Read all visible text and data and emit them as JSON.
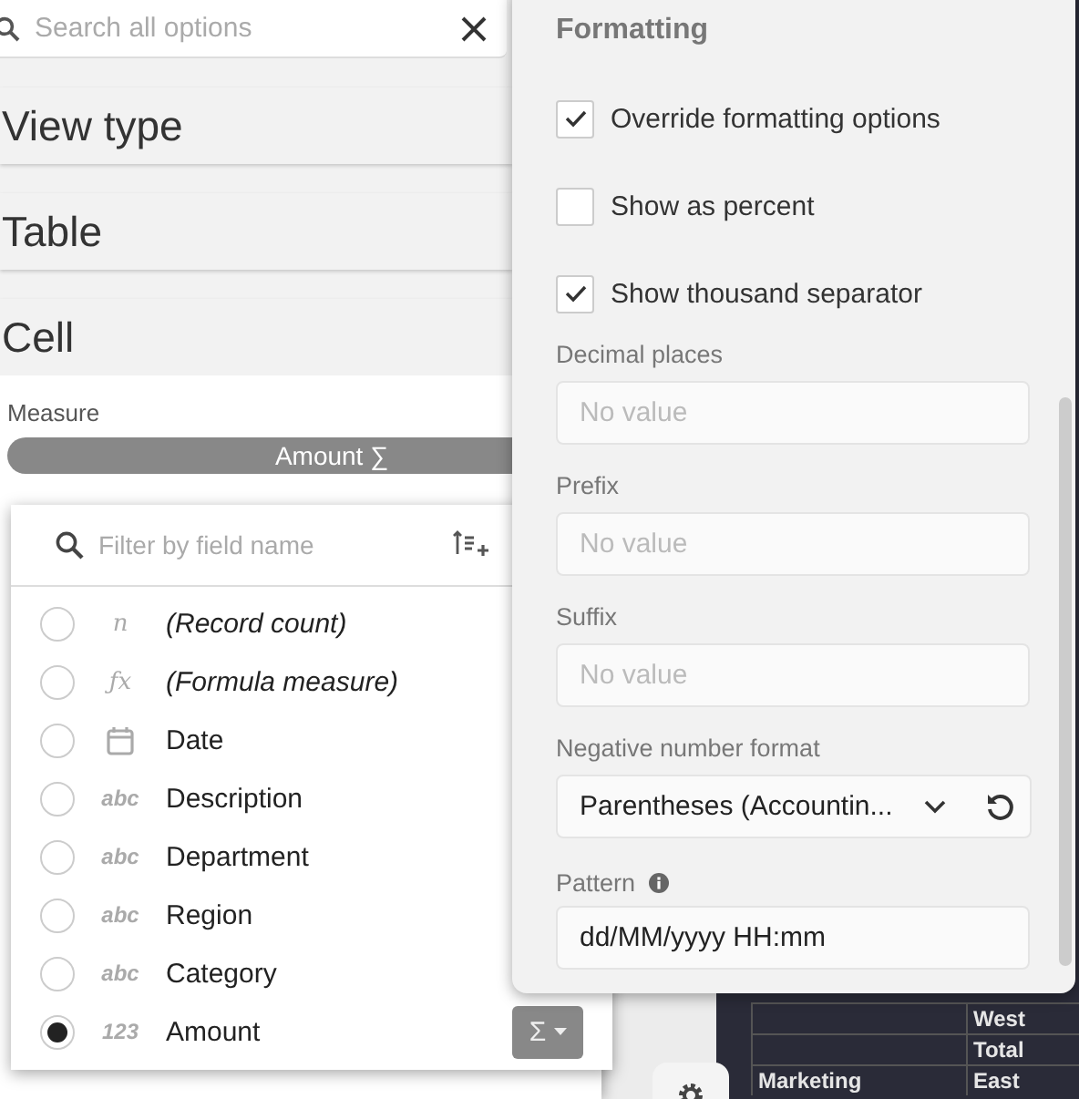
{
  "search": {
    "placeholder": "Search all options"
  },
  "sections": [
    {
      "title": "View type"
    },
    {
      "title": "Table"
    },
    {
      "title": "Cell"
    }
  ],
  "measure": {
    "label": "Measure",
    "value": "Amount",
    "symbol": "∑"
  },
  "field_picker": {
    "filter": {
      "placeholder": "Filter by field name"
    },
    "fields": [
      {
        "kind": "special",
        "badge": "n",
        "label": "(Record count)",
        "selected": false
      },
      {
        "kind": "special",
        "badge": "ƒx",
        "label": "(Formula measure)",
        "selected": false
      },
      {
        "kind": "date",
        "label": "Date",
        "selected": false
      },
      {
        "kind": "text",
        "badge": "abc",
        "label": "Description",
        "selected": false
      },
      {
        "kind": "text",
        "badge": "abc",
        "label": "Department",
        "selected": false
      },
      {
        "kind": "text",
        "badge": "abc",
        "label": "Region",
        "selected": false
      },
      {
        "kind": "text",
        "badge": "abc",
        "label": "Category",
        "selected": false
      },
      {
        "kind": "number",
        "badge": "123",
        "label": "Amount",
        "selected": true
      }
    ],
    "aggregate_button": "Σ"
  },
  "formatting": {
    "title": "Formatting",
    "options": [
      {
        "label": "Override formatting options",
        "checked": true
      },
      {
        "label": "Show as percent",
        "checked": false
      },
      {
        "label": "Show thousand separator",
        "checked": true
      }
    ],
    "fields": [
      {
        "label": "Decimal places",
        "placeholder": "No value"
      },
      {
        "label": "Prefix",
        "placeholder": "No value"
      },
      {
        "label": "Suffix",
        "placeholder": "No value"
      }
    ],
    "negative_format": {
      "label": "Negative number format",
      "value": "Parentheses (Accountin..."
    },
    "pattern": {
      "label": "Pattern",
      "value": "dd/MM/yyyy HH:mm"
    }
  },
  "table": {
    "rows": [
      {
        "column_1": "",
        "column_2": "West"
      },
      {
        "column_1": "",
        "column_2": "Total"
      },
      {
        "column_1": "Marketing",
        "column_2": "East"
      }
    ]
  }
}
